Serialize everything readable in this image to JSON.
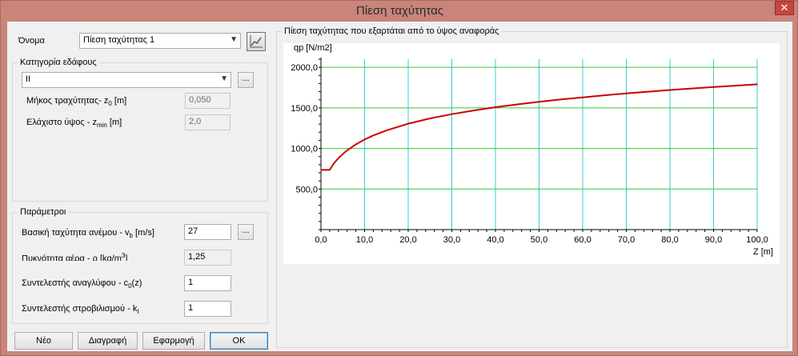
{
  "window": {
    "title": "Πίεση ταχύτητας",
    "close_glyph": "✕"
  },
  "name": {
    "label": "Όνομα",
    "value": "Πίεση ταχύτητας 1"
  },
  "terrain": {
    "legend": "Κατηγορία εδάφους",
    "category_value": "II",
    "roughness_label_pre": "Μήκος τραχύτητας- z",
    "roughness_label_sub": "0",
    "roughness_label_post": " [m]",
    "roughness_value": "0,050",
    "zmin_label_pre": "Ελάχιστο ύψος - z",
    "zmin_label_sub": "min",
    "zmin_label_post": " [m]",
    "zmin_value": "2,0"
  },
  "params": {
    "legend": "Παράμετροι",
    "wind_label_pre": "Βασική ταχύτητα ανέμου - v",
    "wind_label_sub": "b",
    "wind_label_post": " [m/s]",
    "wind_value": "27",
    "density_label_pre": "Πυκνότητα αέρα - ρ [kg/m",
    "density_label_sup": "3",
    "density_label_post": "]",
    "density_value": "1,25",
    "orography_label_pre": "Συντελεστής αναγλύφου - c",
    "orography_label_sub": "0",
    "orography_label_post": "(z)",
    "orography_value": "1",
    "turbulence_label_pre": "Συντελεστής στροβιλισμού - k",
    "turbulence_label_sub": "I",
    "turbulence_value": "1"
  },
  "buttons": {
    "new": "Νέο",
    "delete": "Διαγραφή",
    "apply": "Εφαρμογή",
    "ok": "OK",
    "dots": "..."
  },
  "chart_panel": {
    "legend": "Πίεση ταχύτητας που εξαρτάται από το ύψος αναφοράς"
  },
  "chart_data": {
    "type": "line",
    "ylabel": "qp [N/m2]",
    "xlabel": "Z [m]",
    "xlim": [
      0,
      100
    ],
    "ylim": [
      0,
      2100
    ],
    "x_ticks": [
      "0,0",
      "10,0",
      "20,0",
      "30,0",
      "40,0",
      "50,0",
      "60,0",
      "70,0",
      "80,0",
      "90,0",
      "100,0"
    ],
    "y_ticks": [
      "500,0",
      "1000,0",
      "1500,0",
      "2000,0"
    ],
    "grid": true,
    "grid_color_x": "#33cccc",
    "grid_color_y": "#33cc33",
    "series": [
      {
        "color": "#cc0000",
        "x": [
          0,
          2,
          3,
          4,
          5,
          6,
          8,
          10,
          12,
          15,
          20,
          25,
          30,
          35,
          40,
          45,
          50,
          55,
          60,
          65,
          70,
          75,
          80,
          85,
          90,
          95,
          100
        ],
        "y": [
          735,
          735,
          818,
          880,
          932,
          977,
          1050,
          1110,
          1160,
          1222,
          1305,
          1370,
          1423,
          1468,
          1508,
          1543,
          1575,
          1604,
          1630,
          1655,
          1678,
          1700,
          1720,
          1739,
          1757,
          1774,
          1790
        ]
      }
    ]
  }
}
